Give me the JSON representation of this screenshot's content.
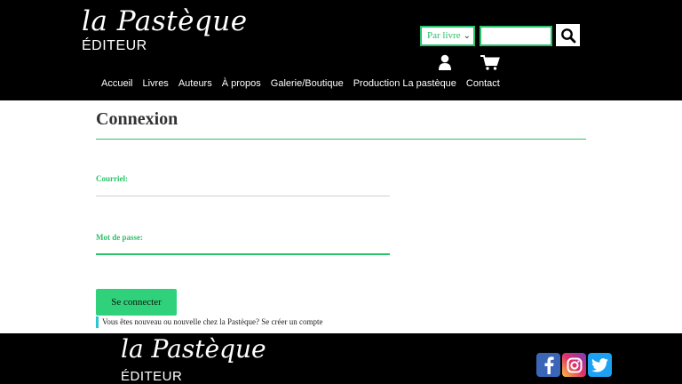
{
  "header": {
    "logo_script": "la Pastèque",
    "logo_sub": "ÉDITEUR",
    "search": {
      "filter_value": "Par livre",
      "input_value": "",
      "button_icon": "search-icon"
    },
    "icons": {
      "account": "user-icon",
      "cart": "cart-icon"
    },
    "nav": [
      "Accueil",
      "Livres",
      "Auteurs",
      "À propos",
      "Galerie/Boutique",
      "Production La pastèque",
      "Contact"
    ]
  },
  "main": {
    "title": "Connexion",
    "email_label": "Courriel:",
    "email_value": "",
    "password_label": "Mot de passe:",
    "password_value": "",
    "submit_label": "Se connecter",
    "signup_text": "Vous êtes nouveau ou nouvelle chez la Pastèque? Se créer un compte"
  },
  "footer": {
    "logo_script": "la Pastèque",
    "logo_sub": "ÉDITEUR",
    "social": [
      "facebook-icon",
      "instagram-icon",
      "twitter-icon"
    ]
  },
  "colors": {
    "accent": "#2bc26b",
    "button": "#2fd27a",
    "header_bg": "#000000"
  }
}
